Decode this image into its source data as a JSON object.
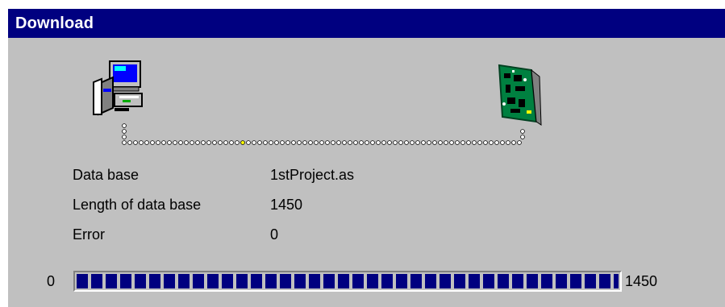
{
  "window": {
    "title": "Download"
  },
  "icons": {
    "source": "computer-icon",
    "target": "circuit-board-icon"
  },
  "transfer": {
    "active_dot_color": "#ffff00",
    "dot_color": "#ffffff"
  },
  "info": {
    "rows": [
      {
        "label": "Data base",
        "value": "1stProject.as"
      },
      {
        "label": "Length of data base",
        "value": "1450"
      },
      {
        "label": "Error",
        "value": "0"
      }
    ]
  },
  "progress": {
    "min_label": "0",
    "max_label": "1450",
    "value": 1450,
    "max": 1450,
    "fill_color": "#000080"
  },
  "colors": {
    "titlebar": "#000080",
    "dialog_bg": "#c0c0c0"
  }
}
